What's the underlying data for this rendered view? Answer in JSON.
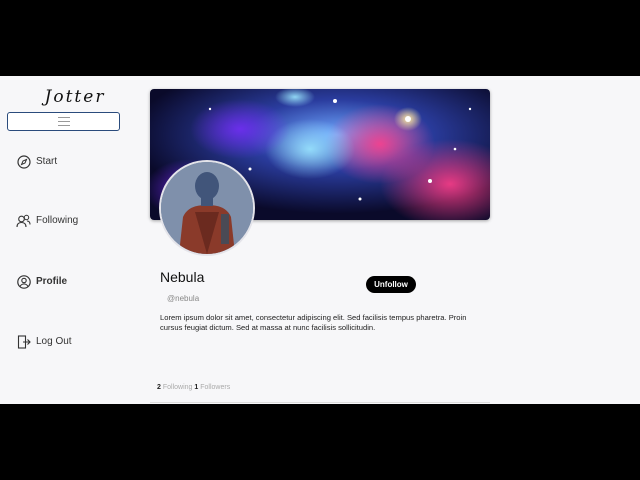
{
  "app": {
    "logo": "Jotter"
  },
  "sidebar": {
    "items": [
      {
        "label": "Start",
        "icon": "compass-icon"
      },
      {
        "label": "Following",
        "icon": "users-icon"
      },
      {
        "label": "Profile",
        "icon": "user-circle-icon",
        "active": true
      },
      {
        "label": "Log Out",
        "icon": "logout-icon"
      }
    ]
  },
  "profile": {
    "name": "Nebula",
    "handle": "@nebula",
    "unfollow_label": "Unfollow",
    "bio": "Lorem ipsum dolor sit amet, consectetur adipiscing elit. Sed facilisis tempus pharetra. Proin cursus feugiat dictum. Sed at massa at nunc facilisis sollicitudin.",
    "following_count": "2",
    "following_label": "Following",
    "followers_count": "1",
    "followers_label": "Followers"
  },
  "colors": {
    "accent": "#2a4b7c",
    "button": "#000000",
    "background": "#f7f7f9"
  }
}
